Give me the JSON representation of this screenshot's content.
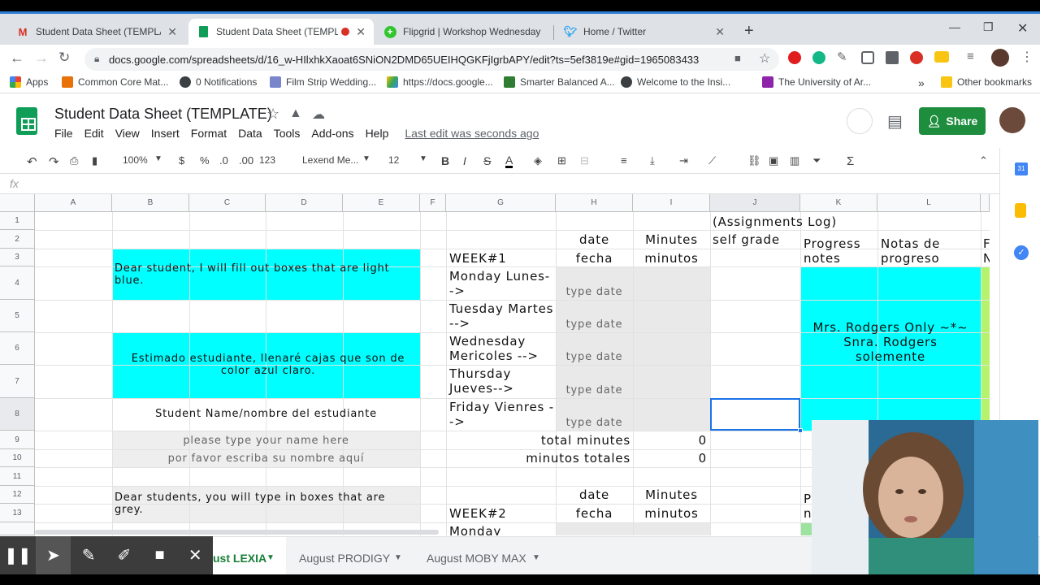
{
  "browser": {
    "tabs": [
      {
        "title": "Student Data Sheet (TEMPLATE)",
        "icon": "gmail-icon"
      },
      {
        "title": "Student Data Sheet (TEMPLA",
        "icon": "sheets-icon"
      },
      {
        "title": "Flipgrid | Workshop Wednesday",
        "icon": "flipgrid-icon"
      },
      {
        "title": "Home / Twitter",
        "icon": "twitter-icon"
      }
    ],
    "url": "docs.google.com/spreadsheets/d/16_w-HIlxhkXaoat6SNiON2DMD65UEIHQGKFjIgrbAPY/edit?ts=5ef3819e#gid=1965083433",
    "bookmarks": [
      "Apps",
      "Common Core Mat...",
      "0 Notifications",
      "Film Strip Wedding...",
      "https://docs.google...",
      "Smarter Balanced A...",
      "Welcome to the Insi...",
      "The University of Ar..."
    ],
    "other_bookmarks": "Other bookmarks",
    "overflow": "»"
  },
  "sheets": {
    "title": "Student Data Sheet (TEMPLATE)",
    "menus": [
      "File",
      "Edit",
      "View",
      "Insert",
      "Format",
      "Data",
      "Tools",
      "Add-ons",
      "Help"
    ],
    "last_edit": "Last edit was seconds ago",
    "share": "Share",
    "toolbar": {
      "zoom": "100%",
      "currency": "$",
      "percent": "%",
      "dec_less": ".0",
      "dec_more": ".00",
      "format": "123",
      "font": "Lexend Me...",
      "size": "12"
    },
    "fx": "fx",
    "columns": [
      "A",
      "B",
      "C",
      "D",
      "E",
      "F",
      "G",
      "H",
      "I",
      "J",
      "K",
      "L"
    ],
    "rows": [
      "1",
      "2",
      "3",
      "4",
      "5",
      "6",
      "7",
      "8",
      "9",
      "10",
      "11",
      "12",
      "13"
    ]
  },
  "cells": {
    "assign_log": "(Assignments Log)",
    "date": "date",
    "minutes": "Minutes",
    "self_grade": "self grade",
    "progress_notes": "Progress notes",
    "notas": "Notas de progreso",
    "l_cut": "F",
    "l_cut2": "N",
    "week1": "WEEK#1",
    "fecha": "fecha",
    "minutos": "minutos",
    "dear_student": "Dear student, I will fill out boxes that are light blue.",
    "estimado": "Estimado estudiante, llenaré cajas que son de color azul claro.",
    "days": [
      "Monday Lunes-->",
      "Tuesday Martes -->",
      "Wednesday Mericoles -->",
      "Thursday Jueves-->",
      "Friday Vienres -->"
    ],
    "type_date": "type date",
    "rodgers": "Mrs. Rodgers Only ~*~ Snra. Rodgers solemente",
    "student_name": "Student Name/nombre del estudiante",
    "please_type": "please type your name here",
    "por_favor": "por favor escriba su nombre aquí",
    "total_minutes": "total minutes",
    "minutos_totales": "minutos totales",
    "zero": "0",
    "dear_students_grey": "Dear students, you will type in boxes that are grey.",
    "week2": "WEEK#2",
    "monday_cut": "Monday",
    "p_cut": "P",
    "n_cut": "n"
  },
  "sheet_tabs": [
    "ust LEXIA",
    "August PRODIGY",
    "August MOBY MAX"
  ],
  "colors": {
    "cyan": "#00ffff",
    "share_green": "#1e8e3e",
    "sheets_green": "#0f9d58",
    "grey_cell": "#eeeeee"
  }
}
